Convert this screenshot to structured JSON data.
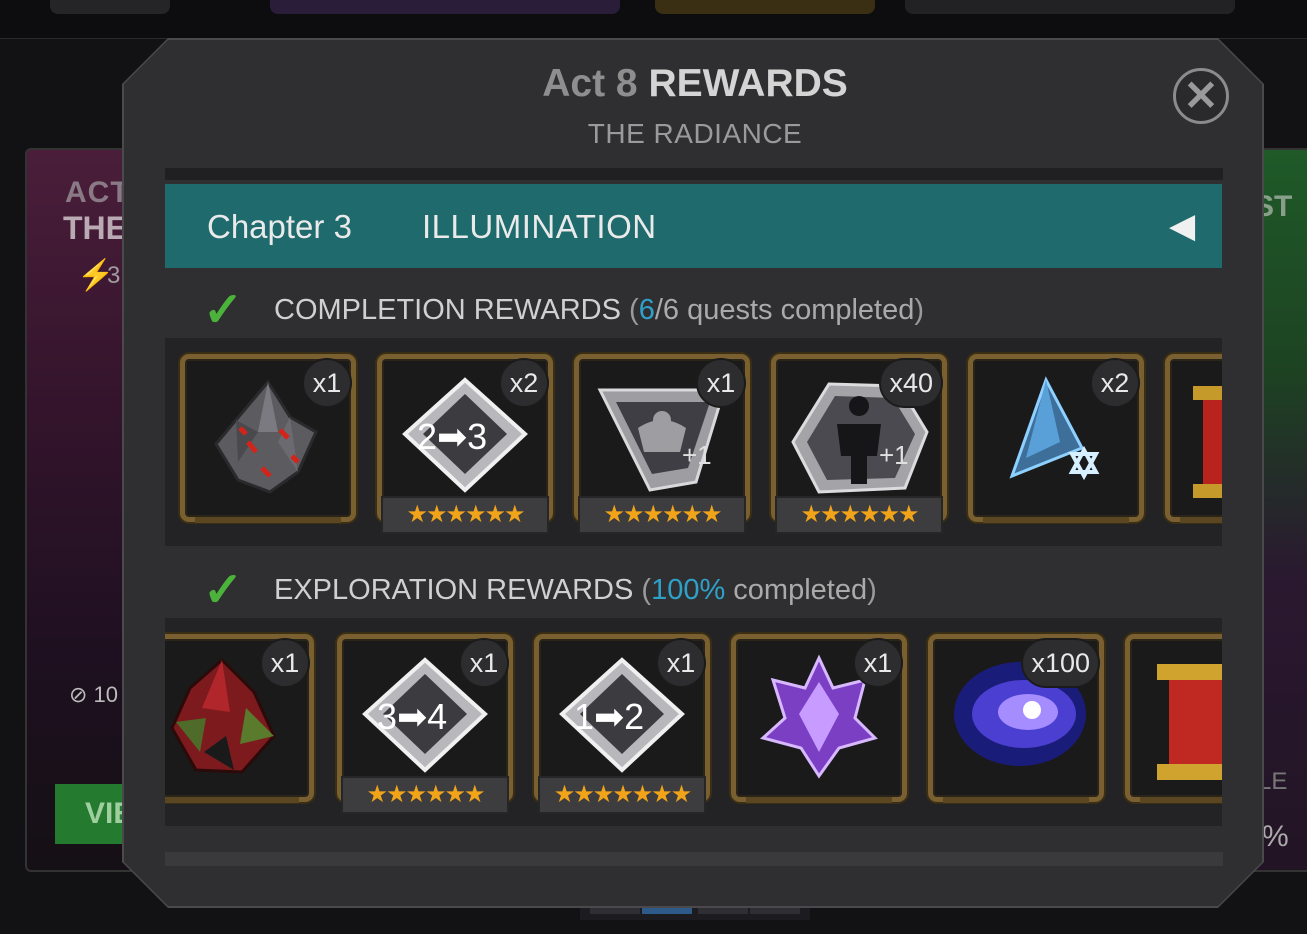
{
  "background": {
    "left_card": {
      "act": "ACT",
      "title": "THE",
      "bolt_count": "3",
      "compass_value": "10",
      "view_button": "VIE"
    },
    "right_card": {
      "title_fragment": "ST",
      "label_fragment": "LE",
      "percent_fragment": "%"
    }
  },
  "modal": {
    "title_prefix": "Act 8",
    "title_main": "REWARDS",
    "subtitle": "THE RADIANCE",
    "close_icon": "close-icon"
  },
  "chapter": {
    "label": "Chapter 3",
    "name": "ILLUMINATION",
    "collapse_icon": "triangle-left-icon"
  },
  "completion": {
    "label": "COMPLETION REWARDS",
    "open_paren": "(",
    "done": "6",
    "separator": "/",
    "total_text": "6 quests completed",
    "close_paren": ")",
    "items": [
      {
        "icon": "gray-crystal-shard-icon",
        "qty": "x1",
        "stars": ""
      },
      {
        "icon": "rank-up-gem-icon",
        "qty": "x2",
        "stars": "★★★★★★",
        "label": "2➡3"
      },
      {
        "icon": "signature-stone-icon",
        "qty": "x1",
        "stars": "★★★★★★",
        "label": "+1"
      },
      {
        "icon": "awakening-gem-icon",
        "qty": "x40",
        "stars": "★★★★★★",
        "label": "+1"
      },
      {
        "icon": "blue-star-shard-icon",
        "qty": "x2",
        "stars": ""
      },
      {
        "icon": "scroll-icon",
        "qty": "",
        "stars": ""
      }
    ]
  },
  "exploration": {
    "label": "EXPLORATION REWARDS",
    "open_paren": "(",
    "pct": "100%",
    "suffix": "completed",
    "close_paren": ")",
    "items": [
      {
        "icon": "red-crystal-icon",
        "qty": "x1",
        "stars": ""
      },
      {
        "icon": "rank-up-gem-icon",
        "qty": "x1",
        "stars": "★★★★★★",
        "label": "3➡4"
      },
      {
        "icon": "rank-up-gem-icon",
        "qty": "x1",
        "stars": "★★★★★★★",
        "label": "1➡2"
      },
      {
        "icon": "purple-crystal-icon",
        "qty": "x1",
        "stars": ""
      },
      {
        "icon": "galaxy-orb-icon",
        "qty": "x100",
        "stars": ""
      },
      {
        "icon": "scroll-icon",
        "qty": "",
        "stars": ""
      }
    ]
  },
  "colors": {
    "teal": "#1e6a6d",
    "gold_frame": "#7a6030",
    "check_green": "#4bb33c",
    "highlight_blue": "#2fa0c8",
    "star_orange": "#f1a41a"
  }
}
